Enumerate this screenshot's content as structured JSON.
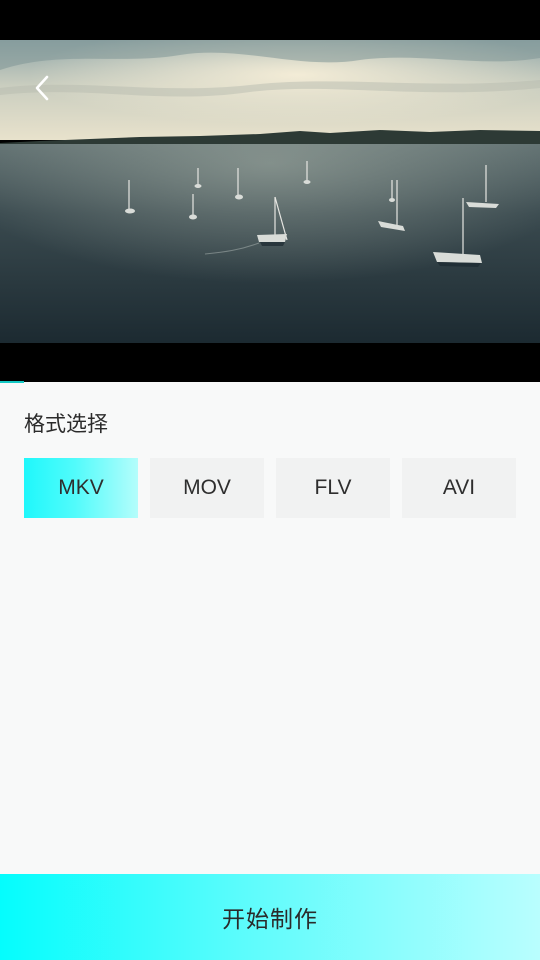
{
  "video": {
    "thumbnail_icon": "seascape-sailboats-image",
    "back_icon": "chevron-left-icon",
    "progress_fraction": 0.044
  },
  "format_section": {
    "title": "格式选择",
    "options": [
      {
        "label": "MKV",
        "selected": true
      },
      {
        "label": "MOV",
        "selected": false
      },
      {
        "label": "FLV",
        "selected": false
      },
      {
        "label": "AVI",
        "selected": false
      }
    ]
  },
  "actions": {
    "start_label": "开始制作"
  },
  "colors": {
    "accent": "#14c8c4",
    "selected_gradient_start": "#1ff8fb",
    "selected_gradient_end": "#b4fdfb",
    "button_gradient_start": "#04fdfd",
    "button_gradient_end": "#b9fefe",
    "background": "#f8f9f9",
    "option_background": "#f1f2f2"
  }
}
